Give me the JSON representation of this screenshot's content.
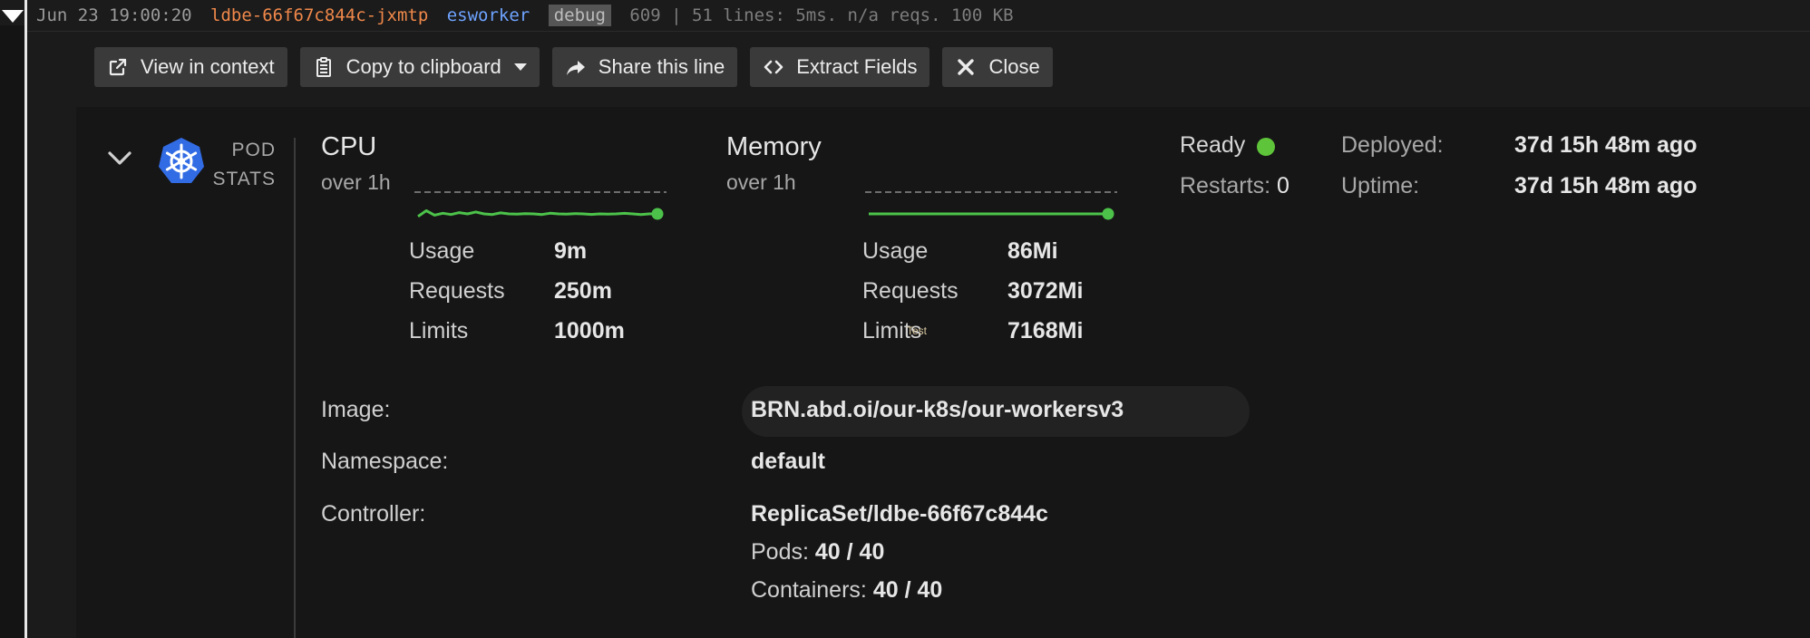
{
  "logline": {
    "date": "Jun 23 19:00:20",
    "pod": "ldbe-66f67c844c-jxmtp",
    "service": "esworker",
    "level": "debug",
    "message": "609 | 51 lines: 5ms. n/a reqs. 100 KB"
  },
  "toolbar": {
    "view_in_context": "View in context",
    "copy_to_clipboard": "Copy to clipboard",
    "share_line": "Share this line",
    "extract_fields": "Extract Fields",
    "close": "Close"
  },
  "pod_stats": {
    "label_line1": "POD",
    "label_line2": "STATS"
  },
  "cpu": {
    "title": "CPU",
    "period": "over 1h",
    "usage_label": "Usage",
    "usage_value": "9m",
    "requests_label": "Requests",
    "requests_value": "250m",
    "limits_label": "Limits",
    "limits_value": "1000m",
    "sparkline": [
      0.1,
      0.55,
      0.2,
      0.35,
      0.25,
      0.4,
      0.3,
      0.45,
      0.3,
      0.25,
      0.38,
      0.3,
      0.28,
      0.32,
      0.3,
      0.25,
      0.35,
      0.3,
      0.28,
      0.32,
      0.3,
      0.26,
      0.3,
      0.28,
      0.3,
      0.34,
      0.3,
      0.25,
      0.3,
      0.3
    ]
  },
  "memory": {
    "title": "Memory",
    "period": "over 1h",
    "usage_label": "Usage",
    "usage_value": "86Mi",
    "requests_label": "Requests",
    "requests_value": "3072Mi",
    "limits_label": "Limits",
    "limits_value": "7168Mi",
    "sparkline": [
      0.3,
      0.3,
      0.3,
      0.3,
      0.3,
      0.3,
      0.3,
      0.3,
      0.3,
      0.3,
      0.3,
      0.3,
      0.3,
      0.3,
      0.3,
      0.3,
      0.3,
      0.3,
      0.3,
      0.3,
      0.3,
      0.3,
      0.3,
      0.3,
      0.3,
      0.3,
      0.3,
      0.3,
      0.3,
      0.3
    ]
  },
  "status": {
    "ready_label": "Ready",
    "restarts_label": "Restarts:",
    "restarts_value": "0",
    "deployed_label": "Deployed:",
    "deployed_value": "37d 15h 48m ago",
    "uptime_label": "Uptime:",
    "uptime_value": "37d 15h 48m ago",
    "ready_color": "#5ec43a"
  },
  "details": {
    "image_label": "Image:",
    "image_value": "BRN.abd.oi/our-k8s/our-workersv3",
    "namespace_label": "Namespace:",
    "namespace_value": "default",
    "controller_label": "Controller:",
    "controller_value": "ReplicaSet/ldbe-66f67c844c",
    "pods_label": "Pods:",
    "pods_value": "40 / 40",
    "containers_label": "Containers:",
    "containers_value": "40 / 40"
  },
  "tooltip_text": "Test",
  "colors": {
    "pod": "#f0884a",
    "service": "#6ea3ff",
    "sparkline": "#4cc24a",
    "k8s_logo": "#326ce5"
  },
  "icons": [
    "external-link-icon",
    "clipboard-icon",
    "share-arrow-icon",
    "code-brackets-icon",
    "close-x-icon",
    "chevron-down-icon",
    "kubernetes-icon"
  ]
}
